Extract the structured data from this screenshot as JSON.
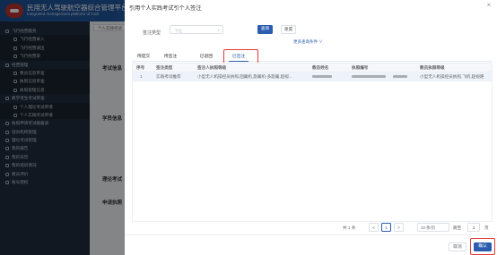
{
  "app": {
    "title": "民用无人驾驶航空器综合管理平台",
    "subtitle": "Integrated management platform of Civil"
  },
  "sidebar": {
    "items": [
      {
        "label": "飞行经营服务",
        "level": 1
      },
      {
        "label": "飞行经营录入",
        "level": 2
      },
      {
        "label": "飞行经营调出",
        "level": 2
      },
      {
        "label": "飞行经营单",
        "level": 2
      },
      {
        "label": "经营管理",
        "level": 1
      },
      {
        "label": "教员信息审查",
        "level": 2
      },
      {
        "label": "执照信息审查",
        "level": 2
      },
      {
        "label": "执照管理信息",
        "level": 2
      },
      {
        "label": "教学考生考试审查",
        "level": 1
      },
      {
        "label": "个人理论考试审请",
        "level": 2
      },
      {
        "label": "个人实践考试审请",
        "level": 2
      },
      {
        "label": "执照申请考试报备表",
        "level": 1
      },
      {
        "label": "培训机构管理",
        "level": 1
      },
      {
        "label": "理论考试管理",
        "level": 1
      },
      {
        "label": "我的报告",
        "level": 1
      },
      {
        "label": "我的日历",
        "level": 1
      },
      {
        "label": "我的培训情况",
        "level": 1
      },
      {
        "label": "教员评价",
        "level": 1
      },
      {
        "label": "账号授权",
        "level": 1
      }
    ]
  },
  "background": {
    "tab": "个人实践考试",
    "labels": [
      "考试信息",
      "学员信息",
      "理论考试",
      "申请执照"
    ]
  },
  "drawer": {
    "title": "引用个人实践考试引个人签注",
    "close_glyph": "×",
    "query": {
      "label": "签注类型",
      "placeholder": "下拉",
      "query_button": "查询",
      "reset_button": "重置",
      "more_conditions": "更多查询条件 ∨"
    },
    "tabs": [
      {
        "label": "待提交",
        "active": false
      },
      {
        "label": "待签注",
        "active": false
      },
      {
        "label": "已退回",
        "active": false
      },
      {
        "label": "已签注",
        "active": true
      }
    ],
    "table": {
      "columns": [
        "序号",
        "签注类型",
        "签注人执照等级",
        "教员姓名",
        "执照编号",
        "",
        "教员执照等级"
      ],
      "rows": [
        {
          "index": "1",
          "type": "实践考试推荐",
          "license_level": "小型无人机操控员执照,固翼机,旋翼机-多旋翼,超视...",
          "teacher_level": "小型无人机操控员执照,飞机,超视距"
        }
      ]
    },
    "pagination": {
      "total": "共 1 条",
      "prev": "<",
      "current_page": "1",
      "next": ">",
      "page_size": "10 条/页",
      "goto_label": "跳至",
      "goto_value": "1",
      "goto_unit": "页"
    },
    "footer": {
      "cancel": "取消",
      "confirm": "确认"
    }
  },
  "colors": {
    "primary": "#2a5db0",
    "header": "#1c4f93",
    "sidebar": "#1f2d3d",
    "highlight": "#e53935"
  }
}
